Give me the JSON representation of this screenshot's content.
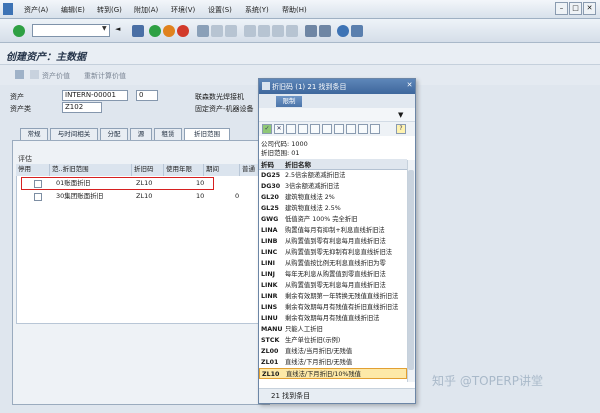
{
  "menu": [
    "资产(A)",
    "编辑(E)",
    "转到(G)",
    "附加(A)",
    "环境(V)",
    "设置(S)",
    "系统(Y)",
    "帮助(H)"
  ],
  "page_title": "创建资产：主数据",
  "app_toolbar": {
    "asset_value": "资产价值",
    "recalc": "重新计算价值"
  },
  "fields": {
    "asset_label": "资产",
    "asset_value": "INTERN-00001",
    "sub_value": "0",
    "asset_desc": "联森数光焊接机",
    "class_label": "资产类",
    "class_value": "Z102",
    "class_desc": "固定资产-机器设备"
  },
  "tabs": [
    "常规",
    "与时间相关",
    "分配",
    "源",
    "租赁",
    "折旧范围"
  ],
  "eval_title": "评估",
  "grid": {
    "headers": [
      "停用",
      "范..折旧范围",
      "折旧码",
      "使用年限",
      "期间",
      "普通"
    ],
    "rows": [
      {
        "range": "01账面折旧",
        "key": "ZL10",
        "years": "10",
        "period": ""
      },
      {
        "range": "30集团账面折旧",
        "key": "ZL10",
        "years": "10",
        "period": "0"
      }
    ]
  },
  "dialog": {
    "title": "折旧码 (1)  21 找到条目",
    "tab": "限制",
    "company_code": "公司代码: 1000",
    "depr_area": "折旧范围: 01",
    "col_key": "折码",
    "col_name": "折旧名称",
    "rows": [
      {
        "key": "DG25",
        "name": "2.5倍余额递减折旧法"
      },
      {
        "key": "DG30",
        "name": "3倍余额递减折旧法"
      },
      {
        "key": "GL20",
        "name": "建筑物直线法 2%"
      },
      {
        "key": "GL25",
        "name": "建筑物直线法 2.5%"
      },
      {
        "key": "GWG",
        "name": "低值资产 100% 完全折旧"
      },
      {
        "key": "LINA",
        "name": "购置值每月有抑制+利息直线折旧法"
      },
      {
        "key": "LINB",
        "name": "从购置值到零有利息每月直线折旧法"
      },
      {
        "key": "LINC",
        "name": "从购置值到零无抑制有利息直线折旧法"
      },
      {
        "key": "LINI",
        "name": "从购置值按比例无利息直线折旧为零"
      },
      {
        "key": "LINJ",
        "name": "每年无利息从购置值到零直线折旧法"
      },
      {
        "key": "LINK",
        "name": "从购置值到零无利息每月直线折旧法"
      },
      {
        "key": "LINR",
        "name": "剩余有效期第一年转换无残值直线折旧法"
      },
      {
        "key": "LINS",
        "name": "剩余有效期每月有残值有折旧直线折旧法"
      },
      {
        "key": "LINU",
        "name": "剩余有效期每月有残值直线折旧法"
      },
      {
        "key": "MANU",
        "name": "只能人工折旧"
      },
      {
        "key": "STCK",
        "name": "生产单位折旧(示例)"
      },
      {
        "key": "ZL00",
        "name": "直线法/当月折旧/无残值"
      },
      {
        "key": "ZL01",
        "name": "直线法/下月折旧/无残值"
      },
      {
        "key": "ZL10",
        "name": "直线法/下月折旧/10%残值"
      }
    ],
    "footer": "21 找到条目"
  },
  "watermark": "知乎 @TOPERP讲堂"
}
